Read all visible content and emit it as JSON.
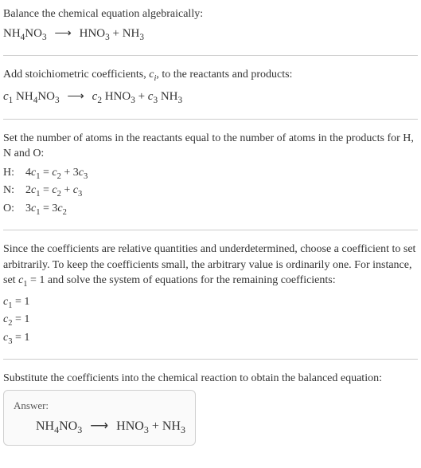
{
  "section1": {
    "intro": "Balance the chemical equation algebraically:",
    "eq_lhs": "NH",
    "eq_lhs_sub1": "4",
    "eq_lhs2": "NO",
    "eq_lhs_sub2": "3",
    "arrow": "⟶",
    "eq_rhs1": "HNO",
    "eq_rhs1_sub": "3",
    "eq_plus": " + ",
    "eq_rhs2": "NH",
    "eq_rhs2_sub": "3"
  },
  "section2": {
    "intro_a": "Add stoichiometric coefficients, ",
    "intro_var": "c",
    "intro_var_sub": "i",
    "intro_b": ", to the reactants and products:",
    "c1": "c",
    "c1_sub": "1",
    "sp1": " NH",
    "sp1_sub1": "4",
    "sp1b": "NO",
    "sp1_sub2": "3",
    "arrow": "⟶",
    "c2": "c",
    "c2_sub": "2",
    "sp2": " HNO",
    "sp2_sub": "3",
    "plus": " + ",
    "c3": "c",
    "c3_sub": "3",
    "sp3": " NH",
    "sp3_sub": "3"
  },
  "section3": {
    "intro": "Set the number of atoms in the reactants equal to the number of atoms in the products for H, N and O:",
    "rows": [
      {
        "label": "H:",
        "lhs_coef": "4",
        "lhs_var": "c",
        "lhs_sub": "1",
        "eq": " = ",
        "r1_var": "c",
        "r1_sub": "2",
        "plus": " + 3",
        "r2_var": "c",
        "r2_sub": "3"
      },
      {
        "label": "N:",
        "lhs_coef": "2",
        "lhs_var": "c",
        "lhs_sub": "1",
        "eq": " = ",
        "r1_var": "c",
        "r1_sub": "2",
        "plus": " + ",
        "r2_var": "c",
        "r2_sub": "3"
      },
      {
        "label": "O:",
        "lhs_coef": "3",
        "lhs_var": "c",
        "lhs_sub": "1",
        "eq": " = 3",
        "r1_var": "c",
        "r1_sub": "2",
        "plus": "",
        "r2_var": "",
        "r2_sub": ""
      }
    ]
  },
  "section4": {
    "intro_a": "Since the coefficients are relative quantities and underdetermined, choose a coefficient to set arbitrarily. To keep the coefficients small, the arbitrary value is ordinarily one. For instance, set ",
    "var": "c",
    "var_sub": "1",
    "intro_b": " = 1 and solve the system of equations for the remaining coefficients:",
    "coeffs": [
      {
        "var": "c",
        "sub": "1",
        "val": " = 1"
      },
      {
        "var": "c",
        "sub": "2",
        "val": " = 1"
      },
      {
        "var": "c",
        "sub": "3",
        "val": " = 1"
      }
    ]
  },
  "section5": {
    "intro": "Substitute the coefficients into the chemical reaction to obtain the balanced equation:",
    "answer_label": "Answer:",
    "eq_lhs": "NH",
    "eq_lhs_sub1": "4",
    "eq_lhs2": "NO",
    "eq_lhs_sub2": "3",
    "arrow": "⟶",
    "eq_rhs1": "HNO",
    "eq_rhs1_sub": "3",
    "eq_plus": " + ",
    "eq_rhs2": "NH",
    "eq_rhs2_sub": "3"
  }
}
